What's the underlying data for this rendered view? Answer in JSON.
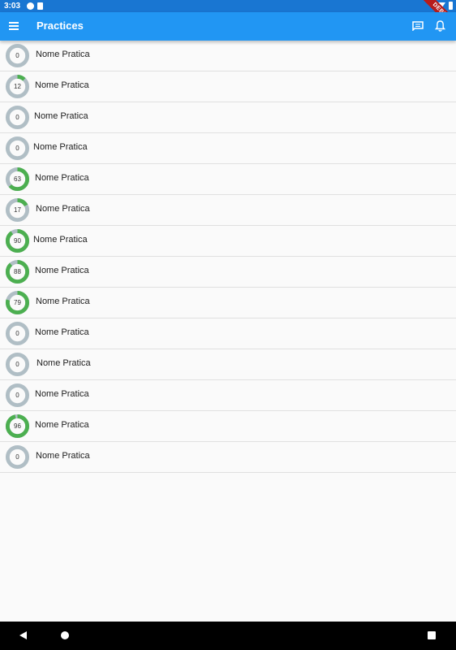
{
  "status_bar": {
    "time": "3:03",
    "debug": "DEBUG"
  },
  "app_bar": {
    "title": "Practices"
  },
  "colors": {
    "primary": "#2196f3",
    "progress": "#4caf50",
    "track": "#b0bec5"
  },
  "practices": [
    {
      "name": "Nome Pratica",
      "progress": 0
    },
    {
      "name": "Nome Pratica",
      "progress": 12
    },
    {
      "name": "Nome Pratica",
      "progress": 0
    },
    {
      "name": "Nome Pratica",
      "progress": 0
    },
    {
      "name": "Nome Pratica",
      "progress": 63
    },
    {
      "name": "Nome Pratica",
      "progress": 17
    },
    {
      "name": "Nome Pratica",
      "progress": 90
    },
    {
      "name": "Nome Pratica",
      "progress": 88
    },
    {
      "name": "Nome Pratica",
      "progress": 79
    },
    {
      "name": "Nome Pratica",
      "progress": 0
    },
    {
      "name": "Nome Pratica",
      "progress": 0
    },
    {
      "name": "Nome Pratica",
      "progress": 0
    },
    {
      "name": "Nome Pratica",
      "progress": 96
    },
    {
      "name": "Nome Pratica",
      "progress": 0
    }
  ]
}
